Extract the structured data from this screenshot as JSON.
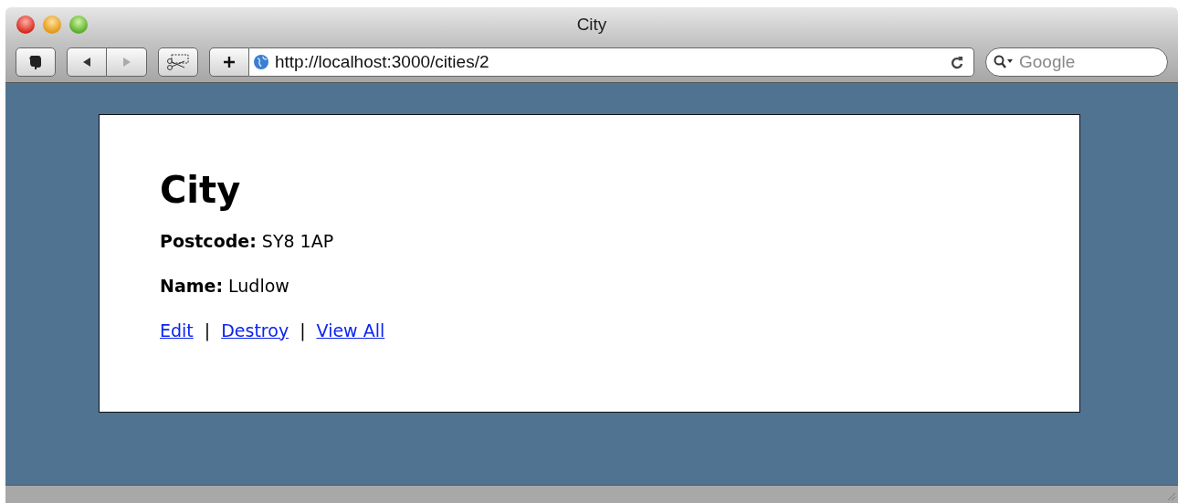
{
  "window": {
    "title": "City"
  },
  "toolbar": {
    "url": "http://localhost:3000/cities/2",
    "search_placeholder": "Google"
  },
  "page": {
    "heading": "City",
    "fields": [
      {
        "text": "**Postcode:** SY8 1AP"
      },
      {
        "text": "**Name:** Ludlow"
      }
    ],
    "links": [
      {
        "label": "Edit"
      },
      {
        "label": "Destroy"
      },
      {
        "label": "View All"
      }
    ],
    "separators": [
      "|",
      "|"
    ]
  }
}
